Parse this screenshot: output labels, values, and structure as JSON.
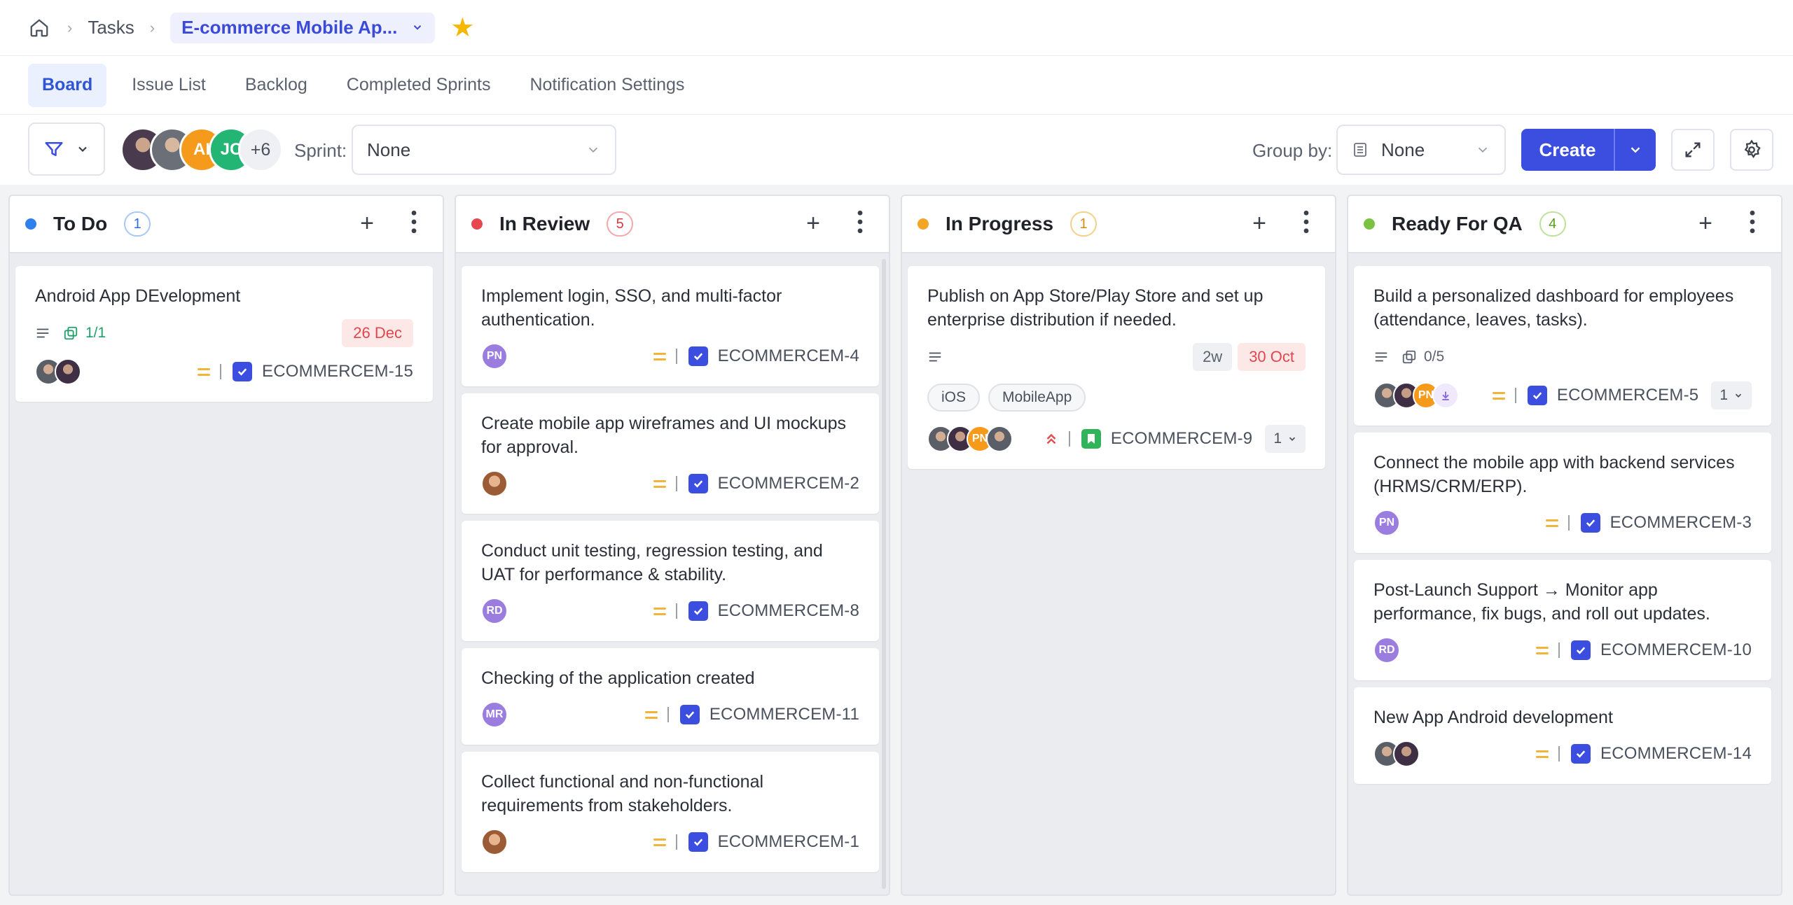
{
  "breadcrumb": {
    "home_icon": "home-icon",
    "tasks": "Tasks",
    "project": "E-commerce Mobile Ap..."
  },
  "tabs": [
    {
      "label": "Board",
      "active": true
    },
    {
      "label": "Issue List",
      "active": false
    },
    {
      "label": "Backlog",
      "active": false
    },
    {
      "label": "Completed Sprints",
      "active": false
    },
    {
      "label": "Notification Settings",
      "active": false
    }
  ],
  "toolbar": {
    "members": [
      "AI",
      "JC"
    ],
    "members_more": "+6",
    "sprint_label": "Sprint:",
    "sprint_value": "None",
    "groupby_label": "Group by:",
    "groupby_value": "None",
    "create_label": "Create"
  },
  "colors": {
    "accent": "#3b4ee0",
    "todo": "#2f80ed",
    "review": "#e5484d",
    "progress": "#f5a524",
    "qa": "#7cc242"
  },
  "columns": [
    {
      "title": "To Do",
      "count": "1",
      "cards": [
        {
          "title": "Android App DEvelopment",
          "subtasks": "1/1",
          "date": "26 Dec",
          "key": "ECOMMERCEM-15"
        }
      ]
    },
    {
      "title": "In Review",
      "count": "5",
      "cards": [
        {
          "title": "Implement login, SSO, and multi-factor authentication.",
          "assignee": "PN",
          "key": "ECOMMERCEM-4"
        },
        {
          "title": "Create mobile app wireframes and UI mockups for approval.",
          "key": "ECOMMERCEM-2"
        },
        {
          "title": "Conduct unit testing, regression testing, and UAT for performance & stability.",
          "assignee": "RD",
          "key": "ECOMMERCEM-8"
        },
        {
          "title": "Checking of the application created",
          "assignee": "MR",
          "key": "ECOMMERCEM-11"
        },
        {
          "title": "Collect functional and non-functional requirements from stakeholders.",
          "key": "ECOMMERCEM-1"
        }
      ]
    },
    {
      "title": "In Progress",
      "count": "1",
      "cards": [
        {
          "title": "Publish on App Store/Play Store and set up enterprise distribution if needed.",
          "estimate": "2w",
          "date": "30 Oct",
          "tags": [
            "iOS",
            "MobileApp"
          ],
          "assignee": "PN",
          "key": "ECOMMERCEM-9",
          "votes": "1"
        }
      ]
    },
    {
      "title": "Ready For QA",
      "count": "4",
      "cards": [
        {
          "title": "Build a personalized dashboard for employees (attendance, leaves, tasks).",
          "subtasks": "0/5",
          "assignee": "PN",
          "key": "ECOMMERCEM-5",
          "votes": "1"
        },
        {
          "title": "Connect the mobile app with backend services (HRMS/CRM/ERP).",
          "assignee": "PN",
          "key": "ECOMMERCEM-3"
        },
        {
          "title": "Post-Launch Support → Monitor app performance, fix bugs, and roll out updates.",
          "assignee": "RD",
          "key": "ECOMMERCEM-10"
        },
        {
          "title": "New App Android development",
          "key": "ECOMMERCEM-14"
        }
      ]
    }
  ]
}
